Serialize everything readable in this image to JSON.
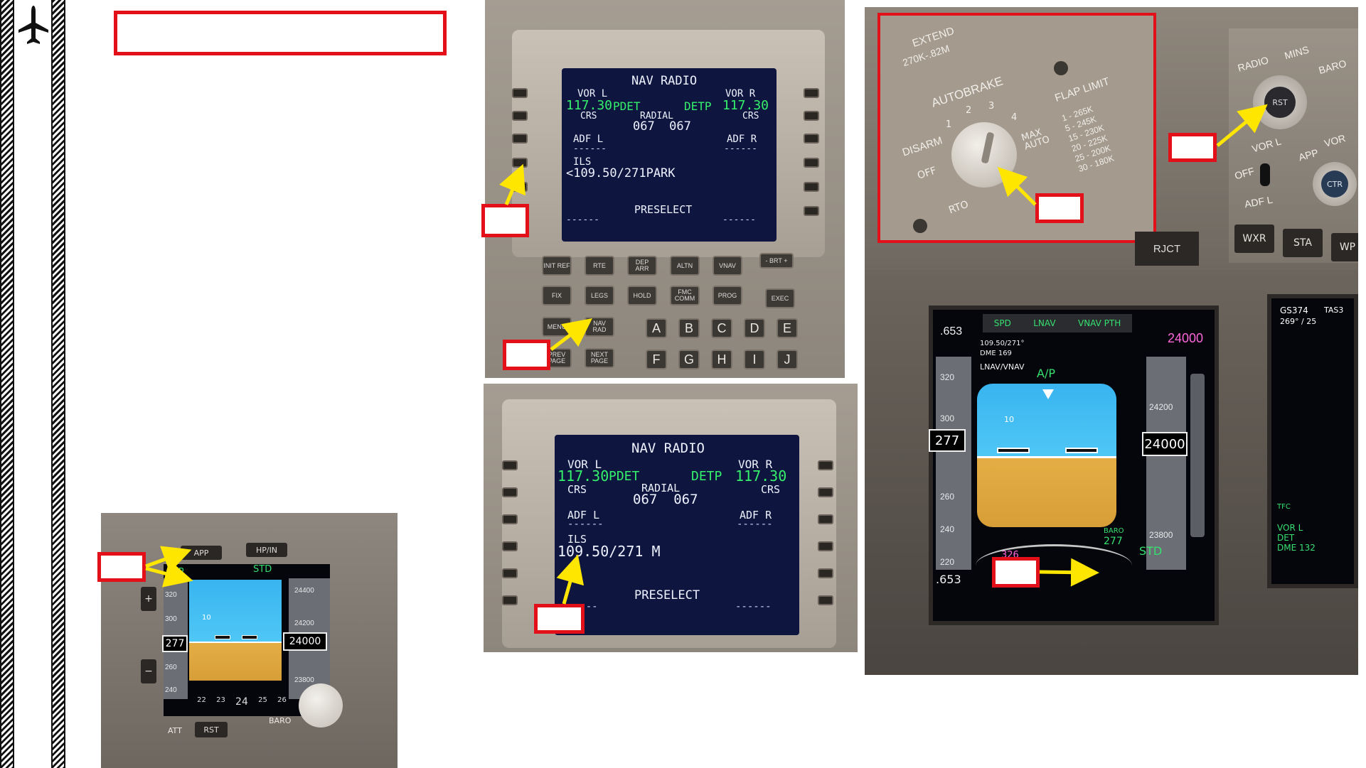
{
  "cdu_top": {
    "title": "NAV RADIO",
    "vor_l_label": "VOR L",
    "vor_r_label": "VOR R",
    "vor_l_freq": "117.30",
    "vor_l_mode": "PDET",
    "vor_r_mode": "DETP",
    "vor_r_freq": "117.30",
    "crs_l": "CRS",
    "radial": "RADIAL",
    "crs_r": "CRS",
    "radial_values": "067  067",
    "adf_l": "ADF L",
    "adf_r": "ADF R",
    "ils_label": "ILS",
    "ils_value": "<109.50/271PARK",
    "preselect": "PRESELECT",
    "keys_row1": [
      "INIT REF",
      "RTE",
      "DEP ARR",
      "ALTN",
      "VNAV"
    ],
    "keys_row2": [
      "FIX",
      "LEGS",
      "HOLD",
      "FMC COMM",
      "PROG"
    ],
    "brt": "- BRT +",
    "exec": "EXEC",
    "menu": "MENU",
    "nav_rad": "NAV RAD",
    "prev_page": "PREV PAGE",
    "next_page": "NEXT PAGE",
    "letters_row1": [
      "A",
      "B",
      "C",
      "D",
      "E"
    ],
    "letters_row2": [
      "F",
      "G",
      "H",
      "I",
      "J"
    ]
  },
  "cdu_bottom": {
    "title": "NAV RADIO",
    "vor_l_label": "VOR L",
    "vor_r_label": "VOR R",
    "vor_l_freq": "117.30",
    "vor_l_mode": "PDET",
    "vor_r_mode": "DETP",
    "vor_r_freq": "117.30",
    "crs_l": "CRS",
    "radial": "RADIAL",
    "crs_r": "CRS",
    "radial_values": "067  067",
    "adf_l": "ADF L",
    "adf_r": "ADF R",
    "ils_label": "ILS",
    "ils_value": "109.50/271 M",
    "preselect": "PRESELECT"
  },
  "autobrake_panel": {
    "extend": "EXTEND",
    "extend_speed": "270K-.82M",
    "autobrake_label": "AUTOBRAKE",
    "positions": [
      "1",
      "2",
      "3",
      "4"
    ],
    "disarm": "DISARM",
    "off": "OFF",
    "rto": "RTO",
    "max_auto": "MAX AUTO",
    "flap_limit_title": "FLAP LIMIT",
    "flap_limits": [
      "1 - 265K",
      "5 - 245K",
      "15 - 230K",
      "20 - 225K",
      "25 - 200K",
      "30 - 180K"
    ],
    "rjct": "RJCT"
  },
  "efis_panel": {
    "radio": "RADIO",
    "mins": "MINS",
    "baro": "BARO",
    "rst": "RST",
    "vor_l": "VOR L",
    "off": "OFF",
    "adf_l": "ADF L",
    "app": "APP",
    "vor": "VOR",
    "ctr": "CTR",
    "wxr": "WXR",
    "sta": "STA",
    "wpt": "WP"
  },
  "pfd_large": {
    "mach": ".653",
    "mach_bottom": ".653",
    "fma_spd": "SPD",
    "fma_lnav": "LNAV",
    "fma_vnav": "VNAV PTH",
    "selected_alt": "24000",
    "ils_info": "109.50/271°",
    "dme": "DME 169",
    "mode": "LNAV/VNAV",
    "ap": "A/P",
    "speed_ticks": [
      "320",
      "300",
      "260",
      "240",
      "220"
    ],
    "current_speed": "277",
    "alt_ticks": [
      "24200",
      "23800"
    ],
    "current_alt": "24000",
    "baro_label": "BARO",
    "baro_value": "277",
    "std": "STD",
    "heading": "326",
    "pitch_10": "10"
  },
  "nd_partial": {
    "gs": "GS374",
    "tas": "TAS3",
    "wind": "269° / 25",
    "tfc": "TFC",
    "vor_l": "VOR L",
    "det": "DET",
    "dme": "DME 132"
  },
  "efis_small": {
    "app_button": "APP",
    "hp_in": "HP/IN",
    "fma_app": "APP",
    "std": "STD",
    "speed_ticks": [
      "320",
      "300",
      "260",
      "240"
    ],
    "current_speed": "277",
    "alt_ticks": [
      "24400",
      "24200",
      "23800"
    ],
    "current_alt": "24000",
    "att": "ATT",
    "rst": "RST",
    "baro": "BARO",
    "heading_ticks": [
      "22",
      "23",
      "24",
      "25",
      "26"
    ],
    "pitch_10": "10"
  }
}
